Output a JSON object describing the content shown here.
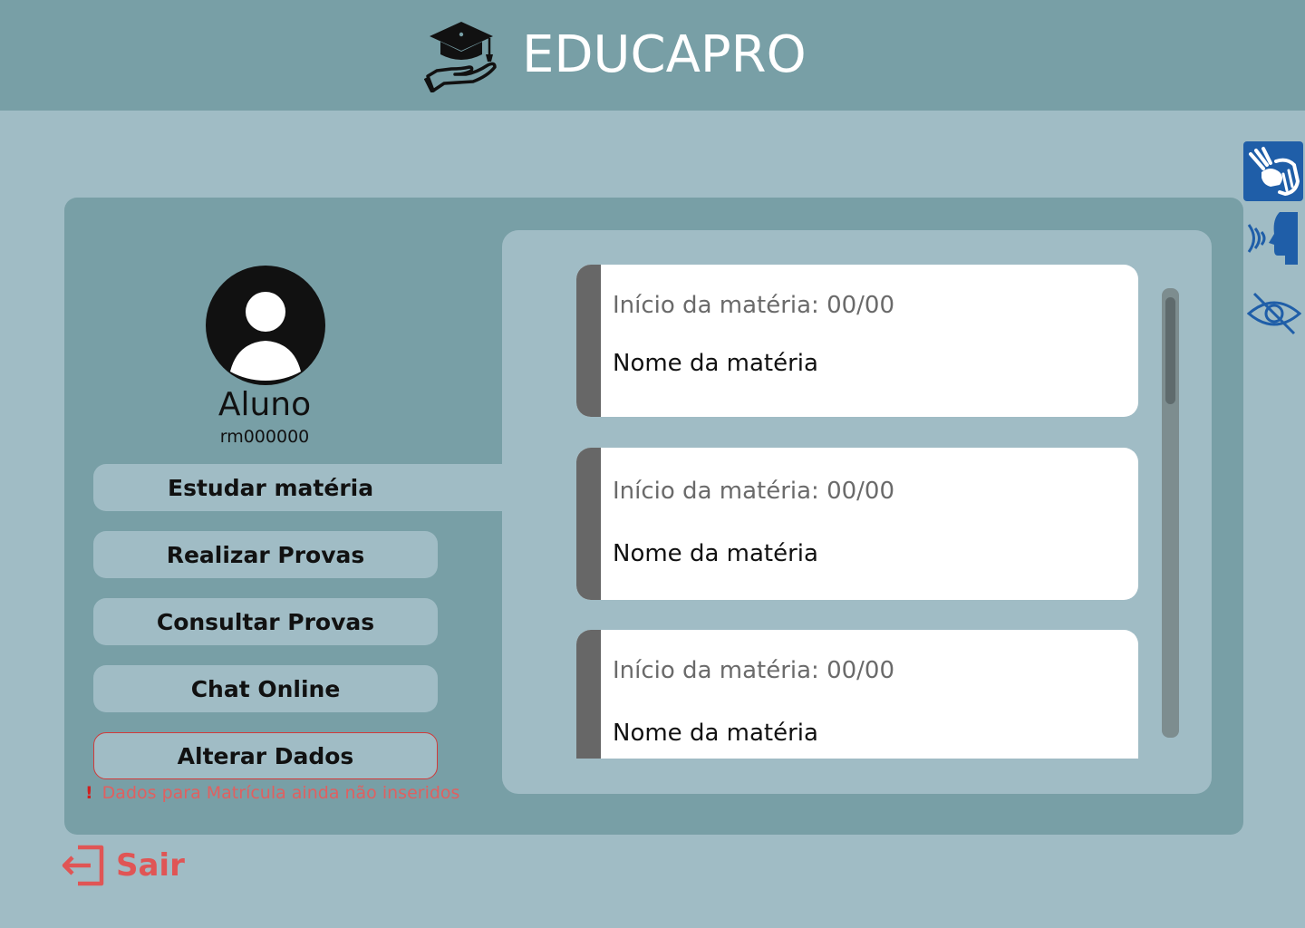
{
  "header": {
    "brand": "EDUCAPRO",
    "logo_icon": "graduation-cap-hand-icon"
  },
  "accessibility": {
    "icons": [
      "sign-language-icon",
      "voice-reader-icon",
      "hide-visibility-icon"
    ],
    "libras_color": "#1f5ea8",
    "icon_color": "#1f5ea8"
  },
  "student": {
    "name": "Aluno",
    "rm": "rm000000",
    "avatar_icon": "user-avatar-icon"
  },
  "nav": {
    "study": "Estudar matéria",
    "exams": "Realizar Provas",
    "consult": "Consultar Provas",
    "chat": "Chat Online",
    "edit": "Alterar Dados"
  },
  "warning": {
    "mark": "!",
    "text": "Dados para Matrícula ainda não inseridos",
    "color": "#e06060"
  },
  "subjects": [
    {
      "start": "Início da matéria: 00/00",
      "name": "Nome da matéria"
    },
    {
      "start": "Início da matéria: 00/00",
      "name": "Nome da matéria"
    },
    {
      "start": "Início da matéria: 00/00",
      "name": "Nome da matéria"
    }
  ],
  "logout": {
    "label": "Sair",
    "icon": "logout-icon",
    "color": "#e05555"
  },
  "colors": {
    "page_bg": "#a0bcc5",
    "header_bg": "#789fa6",
    "card_stripe": "#676767"
  }
}
